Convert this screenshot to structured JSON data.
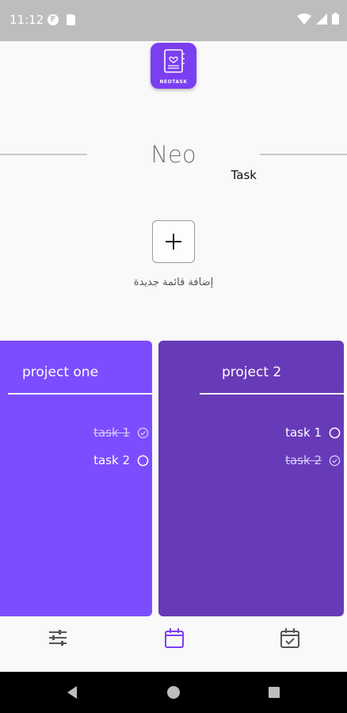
{
  "status_bar": {
    "time": "11:12",
    "notif_letter": "F"
  },
  "logo": {
    "text": "NEOTASK"
  },
  "title": {
    "part1": "Neo",
    "part2": "Task"
  },
  "add_list": {
    "label": "إضافة قائمة جديدة"
  },
  "projects": [
    {
      "title": "project one",
      "tasks": [
        {
          "label": "task 1",
          "done": true
        },
        {
          "label": "task 2",
          "done": false
        }
      ]
    },
    {
      "title": "project 2",
      "tasks": [
        {
          "label": "task 1",
          "done": false
        },
        {
          "label": "task 2",
          "done": true
        }
      ]
    }
  ],
  "bottom_nav": {
    "items": [
      "sliders-icon",
      "calendar-icon",
      "calendar-check-icon"
    ],
    "active_index": 1
  },
  "colors": {
    "accent": "#7b3ff2",
    "card_one": "#7c4dff",
    "card_two": "#673ab7",
    "nav_active": "#7b3ff2",
    "nav_inactive": "#555555"
  }
}
